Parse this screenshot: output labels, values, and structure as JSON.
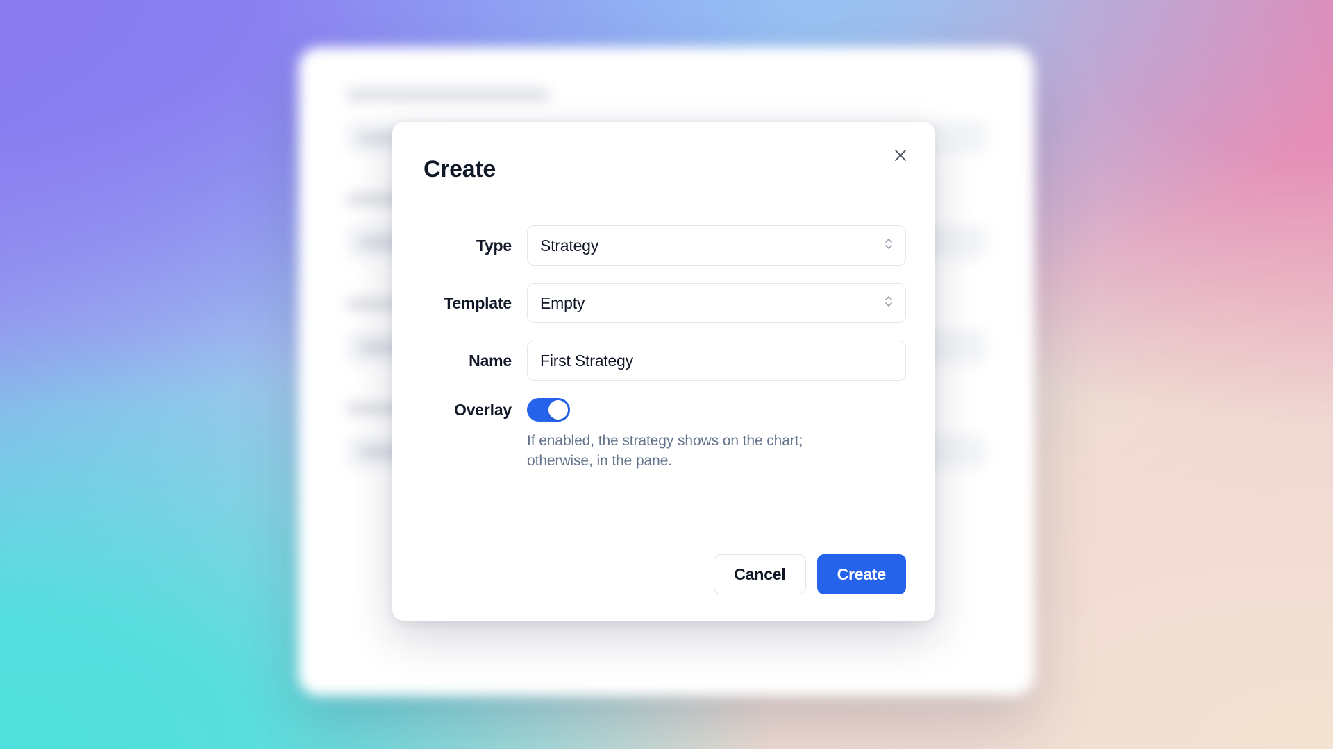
{
  "background": {
    "gradient": {
      "top_left": "#8a7cf0",
      "top_center": "#93c3f5",
      "top_right": "#e588b4",
      "bottom_left": "#4ee0dc",
      "bottom_right": "#f0dfd5"
    },
    "app_card": {
      "blurred": true,
      "rows": [
        {
          "heading": "",
          "field": ""
        },
        {
          "heading": "",
          "field": ""
        },
        {
          "heading": "",
          "field": ""
        },
        {
          "heading": "",
          "field": ""
        }
      ]
    }
  },
  "dialog": {
    "title": "Create",
    "close_icon": "close-icon",
    "form": {
      "type": {
        "label": "Type",
        "value": "Strategy",
        "options": [
          "Strategy"
        ],
        "icon": "chevron-up-down-icon"
      },
      "template": {
        "label": "Template",
        "value": "Empty",
        "options": [
          "Empty"
        ],
        "icon": "chevron-up-down-icon"
      },
      "name": {
        "label": "Name",
        "value": "First Strategy",
        "placeholder": "Name"
      },
      "overlay": {
        "label": "Overlay",
        "enabled": true,
        "hint": "If enabled, the strategy shows on the chart; otherwise, in the pane.",
        "accent_color": "#2563eb"
      }
    },
    "footer": {
      "cancel_label": "Cancel",
      "create_label": "Create",
      "primary_color": "#2563eb"
    }
  }
}
